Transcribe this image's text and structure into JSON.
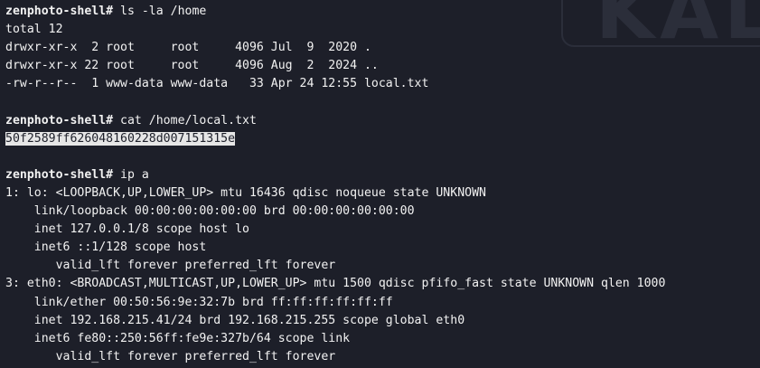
{
  "watermark": "KAL",
  "prompt": "zenphoto-shell#",
  "commands": {
    "ls": "ls -la /home",
    "cat": "cat /home/local.txt",
    "ip": "ip a"
  },
  "ls_output": [
    "total 12",
    "drwxr-xr-x  2 root     root     4096 Jul  9  2020 .",
    "drwxr-xr-x 22 root     root     4096 Aug  2  2024 ..",
    "-rw-r--r--  1 www-data www-data   33 Apr 24 12:55 local.txt"
  ],
  "flag": "50f2589ff626048160228d007151315e",
  "ip_output": [
    "1: lo: <LOOPBACK,UP,LOWER_UP> mtu 16436 qdisc noqueue state UNKNOWN",
    "    link/loopback 00:00:00:00:00:00 brd 00:00:00:00:00:00",
    "    inet 127.0.0.1/8 scope host lo",
    "    inet6 ::1/128 scope host",
    "       valid_lft forever preferred_lft forever",
    "3: eth0: <BROADCAST,MULTICAST,UP,LOWER_UP> mtu 1500 qdisc pfifo_fast state UNKNOWN qlen 1000",
    "    link/ether 00:50:56:9e:32:7b brd ff:ff:ff:ff:ff:ff",
    "    inet 192.168.215.41/24 brd 192.168.215.255 scope global eth0",
    "    inet6 fe80::250:56ff:fe9e:327b/64 scope link",
    "       valid_lft forever preferred_lft forever"
  ]
}
